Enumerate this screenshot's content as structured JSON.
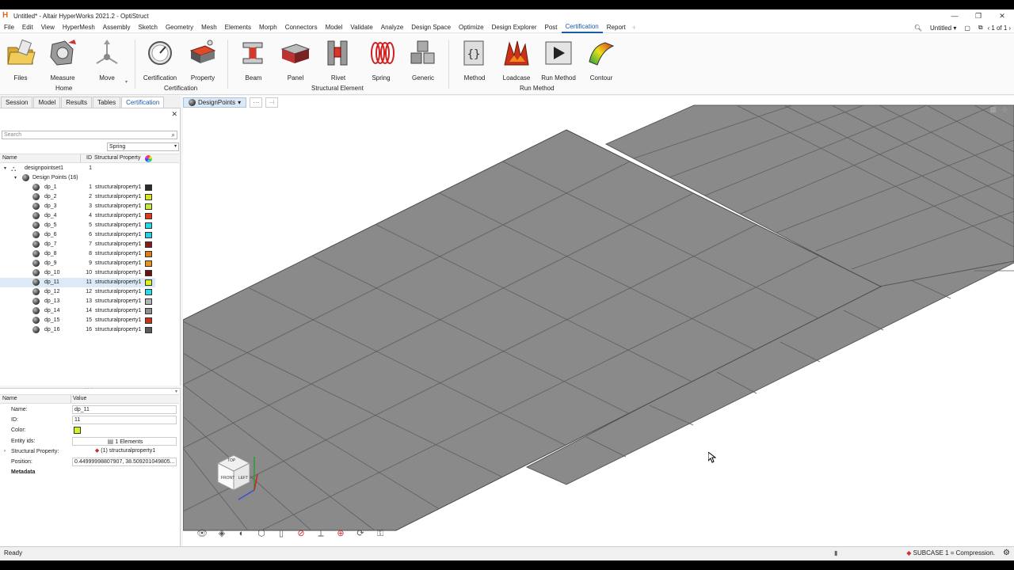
{
  "window": {
    "title": "Untitled* - Altair HyperWorks 2021.2 - OptiStruct",
    "logo_letter": "H",
    "controls": [
      "—",
      "❐",
      "✕"
    ]
  },
  "menu": {
    "items": [
      "File",
      "Edit",
      "View",
      "HyperMesh",
      "Assembly",
      "Sketch",
      "Geometry",
      "Mesh",
      "Elements",
      "Morph",
      "Connectors",
      "Model",
      "Validate",
      "Analyze",
      "Design Space",
      "Optimize",
      "Design Explorer",
      "Post",
      "Certification",
      "Report"
    ],
    "active": "Certification",
    "plus": "+",
    "session": "Untitled",
    "page": "1 of 1"
  },
  "ribbon": {
    "tools": {
      "files": "Files",
      "measure": "Measure",
      "move": "Move",
      "certification": "Certification",
      "property": "Property",
      "beam": "Beam",
      "panel": "Panel",
      "rivet": "Rivet",
      "spring": "Spring",
      "generic": "Generic",
      "method": "Method",
      "loadcase": "Loadcase",
      "run_method": "Run Method",
      "contour": "Contour"
    },
    "groups": {
      "home": "Home",
      "certification": "Certification",
      "structural_element": "Structural Element",
      "run_method": "Run Method"
    }
  },
  "panel_tabs": [
    "Session",
    "Model",
    "Results",
    "Tables",
    "Certification"
  ],
  "panel_tab_active": "Certification",
  "viewport_toolbar": {
    "dropdown": "DesignPoints",
    "more": "···",
    "pin": "⊣"
  },
  "browser": {
    "search_placeholder": "Search",
    "type_filter": "Spring",
    "columns": {
      "name": "Name",
      "id": "ID",
      "prop": "Structural Property"
    },
    "root": {
      "name": "designpointset1",
      "id": "1"
    },
    "folder": "Design Points (16)",
    "rows": [
      {
        "name": "dp_1",
        "id": "1",
        "prop": "structuralproperty1",
        "color": "#2b2b2b"
      },
      {
        "name": "dp_2",
        "id": "2",
        "prop": "structuralproperty1",
        "color": "#d4e620"
      },
      {
        "name": "dp_3",
        "id": "3",
        "prop": "structuralproperty1",
        "color": "#c6ea3a"
      },
      {
        "name": "dp_4",
        "id": "4",
        "prop": "structuralproperty1",
        "color": "#e2391c"
      },
      {
        "name": "dp_5",
        "id": "5",
        "prop": "structuralproperty1",
        "color": "#25d8e8"
      },
      {
        "name": "dp_6",
        "id": "6",
        "prop": "structuralproperty1",
        "color": "#25d0e4"
      },
      {
        "name": "dp_7",
        "id": "7",
        "prop": "structuralproperty1",
        "color": "#8b1a1a"
      },
      {
        "name": "dp_8",
        "id": "8",
        "prop": "structuralproperty1",
        "color": "#e07b1a"
      },
      {
        "name": "dp_9",
        "id": "9",
        "prop": "structuralproperty1",
        "color": "#e8931c"
      },
      {
        "name": "dp_10",
        "id": "10",
        "prop": "structuralproperty1",
        "color": "#6b1111"
      },
      {
        "name": "dp_11",
        "id": "11",
        "prop": "structuralproperty1",
        "color": "#d6f020"
      },
      {
        "name": "dp_12",
        "id": "12",
        "prop": "structuralproperty1",
        "color": "#28dbe6"
      },
      {
        "name": "dp_13",
        "id": "13",
        "prop": "structuralproperty1",
        "color": "#b4b4b4"
      },
      {
        "name": "dp_14",
        "id": "14",
        "prop": "structuralproperty1",
        "color": "#8e8e8e"
      },
      {
        "name": "dp_15",
        "id": "15",
        "prop": "structuralproperty1",
        "color": "#c8321a"
      },
      {
        "name": "dp_16",
        "id": "16",
        "prop": "structuralproperty1",
        "color": "#5a5a5a"
      }
    ],
    "selected": "dp_11"
  },
  "properties": {
    "columns": {
      "name": "Name",
      "value": "Value"
    },
    "rows": {
      "name_label": "Name:",
      "name_value": "dp_11",
      "id_label": "ID:",
      "id_value": "11",
      "color_label": "Color:",
      "color_value": "#d6f020",
      "entity_label": "Entity ids:",
      "entity_value": "1 Elements",
      "sprop_label": "Structural Property:",
      "sprop_value": "(1) structuralproperty1",
      "pos_label": "Position:",
      "pos_value": "0.44999998807907, 38.509201049805..."
    },
    "metadata": "Metadata"
  },
  "viewcube": {
    "top": "TOP",
    "left": "LEFT",
    "front": "FRONT",
    "x": "X",
    "z": "Z"
  },
  "status": {
    "left": "Ready",
    "right": "SUBCASE 1 = Compression."
  },
  "colors": {
    "mesh_fill": "#8a8a8a",
    "mesh_line": "#585858",
    "accent": "#1b5aa6"
  }
}
